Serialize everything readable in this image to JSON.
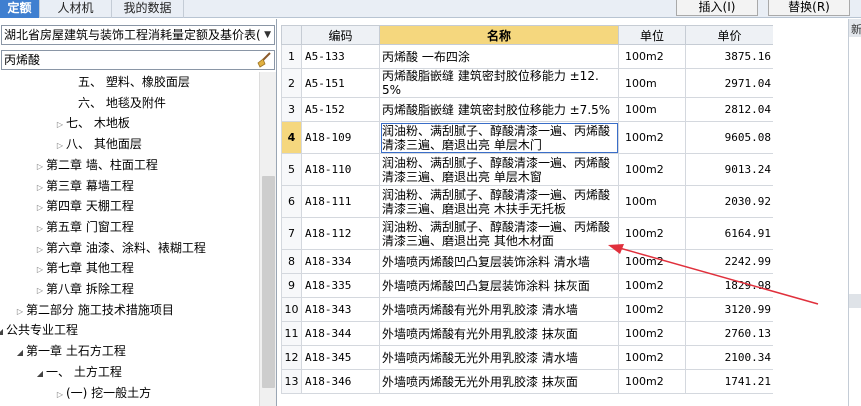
{
  "tabs": [
    {
      "label": "定额",
      "active": true
    },
    {
      "label": "人材机",
      "active": false
    },
    {
      "label": "我的数据",
      "active": false
    }
  ],
  "toolbar": {
    "insert_label": "插入(I)",
    "replace_label": "替换(R)"
  },
  "left": {
    "quota_library": "湖北省房屋建筑与装饰工程消耗量定额及基价表(",
    "search_value": "丙烯酸",
    "tree": [
      {
        "label": "五、 塑料、橡胶面层",
        "indent": 80,
        "toggle": "none"
      },
      {
        "label": "六、 地毯及附件",
        "indent": 80,
        "toggle": "none"
      },
      {
        "label": "七、 木地板",
        "indent": 68,
        "toggle": "closed"
      },
      {
        "label": "八、 其他面层",
        "indent": 68,
        "toggle": "closed"
      },
      {
        "label": "第二章 墙、柱面工程",
        "indent": 48,
        "toggle": "closed"
      },
      {
        "label": "第三章 幕墙工程",
        "indent": 48,
        "toggle": "closed"
      },
      {
        "label": "第四章 天棚工程",
        "indent": 48,
        "toggle": "closed"
      },
      {
        "label": "第五章 门窗工程",
        "indent": 48,
        "toggle": "closed"
      },
      {
        "label": "第六章 油漆、涂料、裱糊工程",
        "indent": 48,
        "toggle": "closed"
      },
      {
        "label": "第七章 其他工程",
        "indent": 48,
        "toggle": "closed"
      },
      {
        "label": "第八章 拆除工程",
        "indent": 48,
        "toggle": "closed"
      },
      {
        "label": "第二部分 施工技术措施项目",
        "indent": 28,
        "toggle": "closed"
      },
      {
        "label": "公共专业工程",
        "indent": 8,
        "toggle": "open"
      },
      {
        "label": "第一章 土石方工程",
        "indent": 28,
        "toggle": "open"
      },
      {
        "label": "一、 土方工程",
        "indent": 48,
        "toggle": "open"
      },
      {
        "label": "(一) 挖一般土方",
        "indent": 68,
        "toggle": "closed"
      }
    ]
  },
  "grid": {
    "headers": {
      "code": "编码",
      "name": "名称",
      "unit": "单位",
      "price": "单价"
    },
    "rows": [
      {
        "no": "1",
        "code": "A5-133",
        "name": "丙烯酸 一布四涂",
        "unit": "100m2",
        "price": "3875.16"
      },
      {
        "no": "2",
        "code": "A5-151",
        "name": "丙烯酸脂嵌缝 建筑密封胶位移能力 ±12.5%",
        "unit": "100m",
        "price": "2971.04"
      },
      {
        "no": "3",
        "code": "A5-152",
        "name": "丙烯酸脂嵌缝 建筑密封胶位移能力 ±7.5%",
        "unit": "100m",
        "price": "2812.04"
      },
      {
        "no": "4",
        "code": "A18-109",
        "name": "润油粉、满刮腻子、醇酸清漆一遍、丙烯酸清漆三遍、磨退出亮 单层木门",
        "unit": "100m2",
        "price": "9605.08",
        "current": true
      },
      {
        "no": "5",
        "code": "A18-110",
        "name": "润油粉、满刮腻子、醇酸清漆一遍、丙烯酸清漆三遍、磨退出亮 单层木窗",
        "unit": "100m2",
        "price": "9013.24"
      },
      {
        "no": "6",
        "code": "A18-111",
        "name": "润油粉、满刮腻子、醇酸清漆一遍、丙烯酸清漆三遍、磨退出亮 木扶手无托板",
        "unit": "100m",
        "price": "2030.92"
      },
      {
        "no": "7",
        "code": "A18-112",
        "name": "润油粉、满刮腻子、醇酸清漆一遍、丙烯酸清漆三遍、磨退出亮 其他木材面",
        "unit": "100m2",
        "price": "6164.91"
      },
      {
        "no": "8",
        "code": "A18-334",
        "name": "外墙喷丙烯酸凹凸复层装饰涂料 清水墙",
        "unit": "100m2",
        "price": "2242.99"
      },
      {
        "no": "9",
        "code": "A18-335",
        "name": "外墙喷丙烯酸凹凸复层装饰涂料 抹灰面",
        "unit": "100m2",
        "price": "1829.98"
      },
      {
        "no": "10",
        "code": "A18-343",
        "name": "外墙喷丙烯酸有光外用乳胶漆 清水墙",
        "unit": "100m2",
        "price": "3120.99"
      },
      {
        "no": "11",
        "code": "A18-344",
        "name": "外墙喷丙烯酸有光外用乳胶漆 抹灰面",
        "unit": "100m2",
        "price": "2760.13"
      },
      {
        "no": "12",
        "code": "A18-345",
        "name": "外墙喷丙烯酸无光外用乳胶漆 清水墙",
        "unit": "100m2",
        "price": "2100.34"
      },
      {
        "no": "13",
        "code": "A18-346",
        "name": "外墙喷丙烯酸无光外用乳胶漆 抹灰面",
        "unit": "100m2",
        "price": "1741.21"
      }
    ]
  },
  "right_strip": {
    "label": "新"
  },
  "colors": {
    "accent": "#3f7fd0",
    "selected_header": "#f5d77e",
    "annotation_arrow": "#e0303c"
  }
}
